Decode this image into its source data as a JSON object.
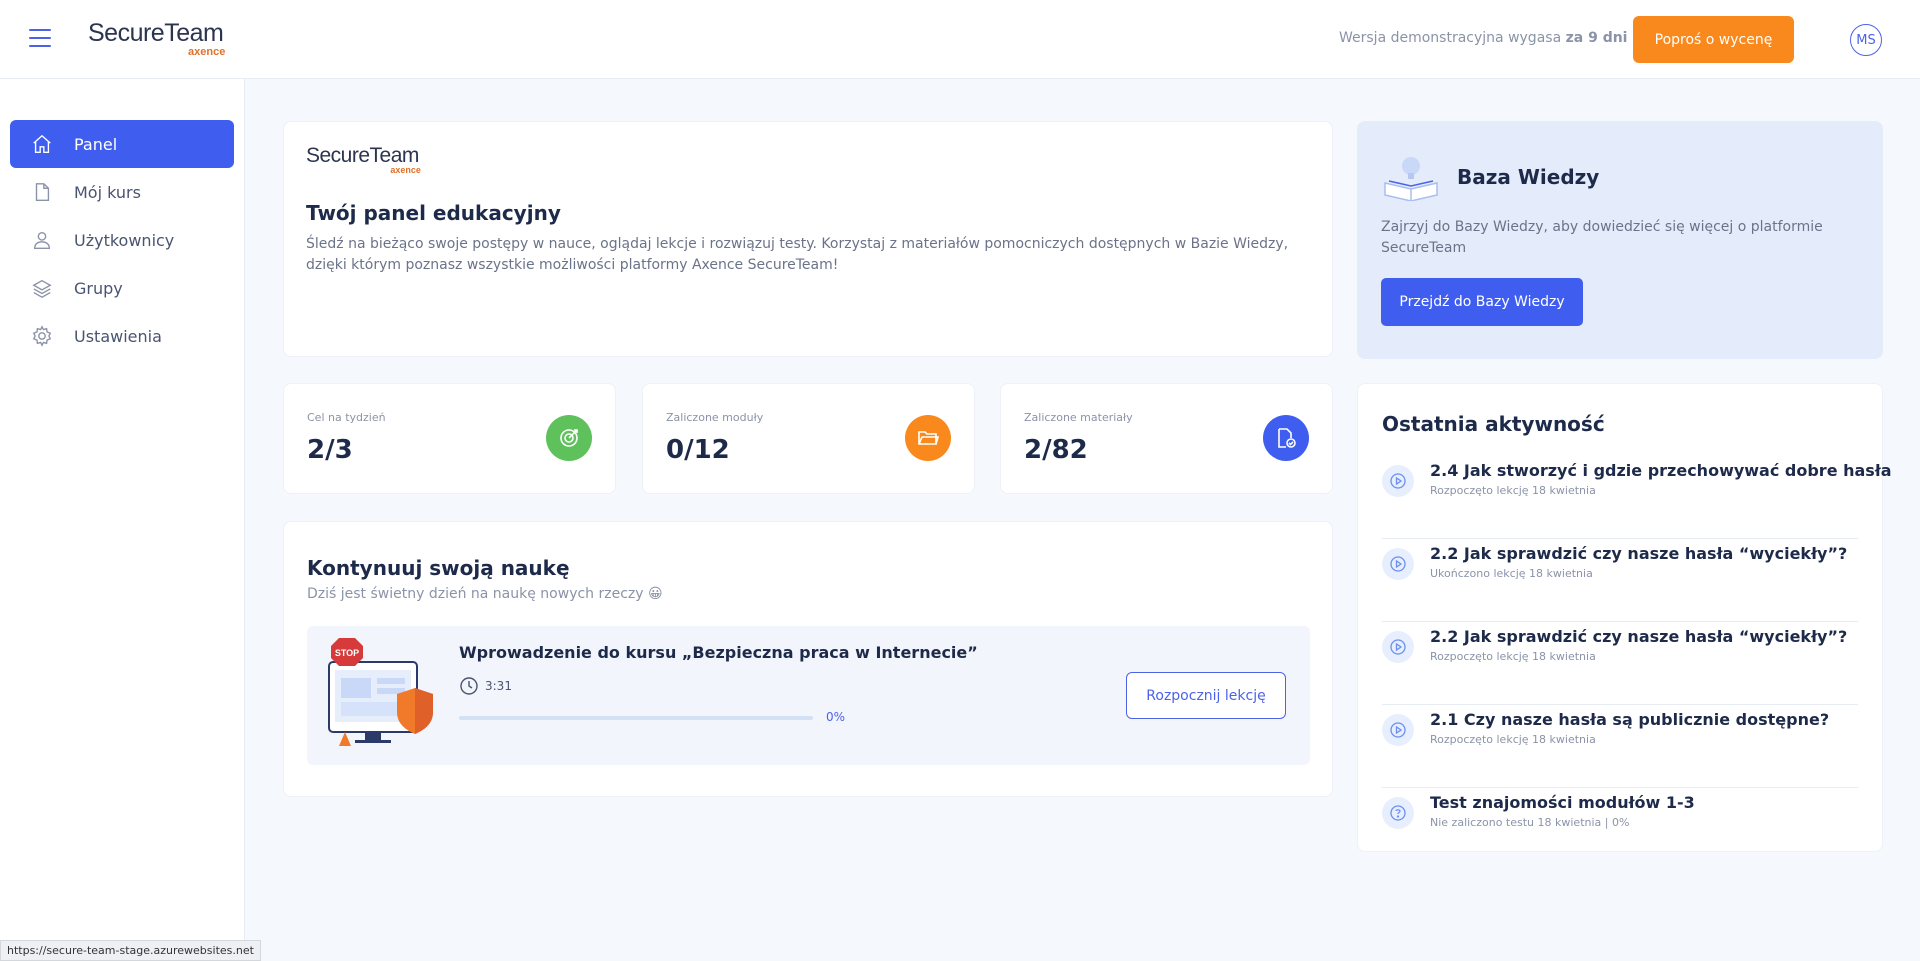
{
  "header": {
    "logo_main": "SecureTeam",
    "logo_sub": "axence",
    "trial_text": "Wersja demonstracyjna wygasa",
    "trial_days": "za 9 dni",
    "quote_button": "Poproś o wycenę",
    "avatar_initials": "MS"
  },
  "sidebar": {
    "items": [
      {
        "label": "Panel",
        "icon": "home-icon"
      },
      {
        "label": "Mój kurs",
        "icon": "document-icon"
      },
      {
        "label": "Użytkownicy",
        "icon": "user-icon"
      },
      {
        "label": "Grupy",
        "icon": "layers-icon"
      },
      {
        "label": "Ustawienia",
        "icon": "gear-icon"
      }
    ]
  },
  "welcome": {
    "logo_main": "SecureTeam",
    "logo_sub": "axence",
    "title": "Twój panel edukacyjny",
    "description": "Śledź na bieżąco swoje postępy w nauce, oglądaj lekcje i rozwiązuj testy. Korzystaj z materiałów pomocniczych dostępnych w Bazie Wiedzy, dzięki którym poznasz wszystkie możliwości platformy Axence SecureTeam!"
  },
  "knowledge_base": {
    "title": "Baza Wiedzy",
    "description": "Zajrzyj do Bazy Wiedzy, aby dowiedzieć się więcej o platformie SecureTeam",
    "button": "Przejdź do Bazy Wiedzy"
  },
  "stats": [
    {
      "label": "Cel na tydzień",
      "value": "2/3",
      "color": "#5fc15b",
      "icon": "target-icon"
    },
    {
      "label": "Zaliczone moduły",
      "value": "0/12",
      "color": "#f9891c",
      "icon": "folder-icon"
    },
    {
      "label": "Zaliczone materiały",
      "value": "2/82",
      "color": "#3f5ef0",
      "icon": "file-check-icon"
    }
  ],
  "continue": {
    "title": "Kontynuuj swoją naukę",
    "subtitle": "Dziś jest świetny dzień na naukę nowych rzeczy 😀",
    "lesson": {
      "title": "Wprowadzenie do kursu „Bezpieczna praca w Internecie”",
      "duration": "3:31",
      "progress": 0,
      "progress_label": "0%",
      "button": "Rozpocznij lekcję"
    }
  },
  "activity": {
    "title": "Ostatnia aktywność",
    "items": [
      {
        "name": "2.4 Jak stworzyć i gdzie przechowywać dobre hasła",
        "meta": "Rozpoczęto lekcję 18 kwietnia",
        "icon": "play-icon"
      },
      {
        "name": "2.2 Jak sprawdzić czy nasze hasła “wyciekły”?",
        "meta": "Ukończono lekcję 18 kwietnia",
        "icon": "play-icon"
      },
      {
        "name": "2.2 Jak sprawdzić czy nasze hasła “wyciekły”?",
        "meta": "Rozpoczęto lekcję 18 kwietnia",
        "icon": "play-icon"
      },
      {
        "name": "2.1 Czy nasze hasła są publicznie dostępne?",
        "meta": "Rozpoczęto lekcję 18 kwietnia",
        "icon": "play-icon"
      },
      {
        "name": "Test znajomości modułów 1-3",
        "meta": "Nie zaliczono testu 18 kwietnia | 0%",
        "icon": "question-icon"
      }
    ]
  },
  "status_url": "https://secure-team-stage.azurewebsites.net"
}
